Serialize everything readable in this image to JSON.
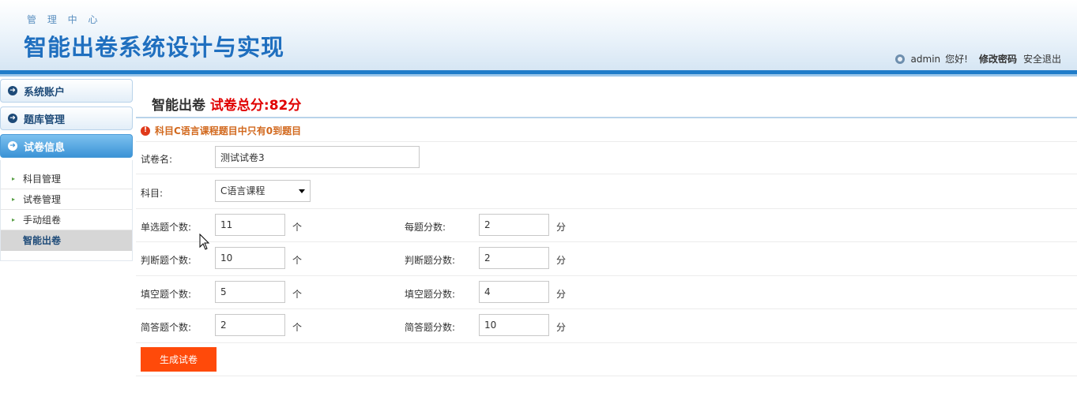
{
  "header": {
    "subtitle": "管 理 中 心",
    "title": "智能出卷系统设计与实现",
    "user": "admin",
    "greeting": "您好!",
    "change_password": "修改密码",
    "logout": "安全退出"
  },
  "sidebar": {
    "menus": [
      {
        "label": "系统账户"
      },
      {
        "label": "题库管理"
      },
      {
        "label": "试卷信息"
      }
    ],
    "sub_items": [
      {
        "label": "科目管理"
      },
      {
        "label": "试卷管理"
      },
      {
        "label": "手动组卷"
      },
      {
        "label": "智能出卷"
      }
    ]
  },
  "main": {
    "title": "智能出卷",
    "score_text": "试卷总分:82分",
    "error": "科目C语言课程题目中只有0到题目",
    "paper_name_label": "试卷名:",
    "paper_name_value": "测试试卷3",
    "subject_label": "科目:",
    "subject_value": "C语言课程",
    "rows": [
      {
        "count_label": "单选题个数:",
        "count_value": "11",
        "count_unit": "个",
        "score_label": "每题分数:",
        "score_value": "2",
        "score_unit": "分"
      },
      {
        "count_label": "判断题个数:",
        "count_value": "10",
        "count_unit": "个",
        "score_label": "判断题分数:",
        "score_value": "2",
        "score_unit": "分"
      },
      {
        "count_label": "填空题个数:",
        "count_value": "5",
        "count_unit": "个",
        "score_label": "填空题分数:",
        "score_value": "4",
        "score_unit": "分"
      },
      {
        "count_label": "简答题个数:",
        "count_value": "2",
        "count_unit": "个",
        "score_label": "简答题分数:",
        "score_value": "10",
        "score_unit": "分"
      }
    ],
    "generate_button": "生成试卷"
  },
  "colors": {
    "brand_blue": "#1f6fbf",
    "score_red": "#e00000",
    "error_orange": "#d2691e",
    "button_orange": "#ff4a0a"
  }
}
